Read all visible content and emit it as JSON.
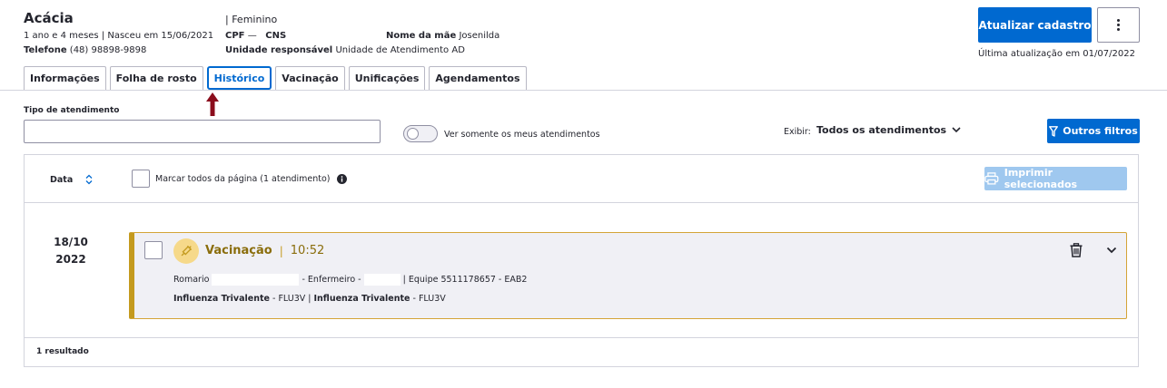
{
  "patient": {
    "name": "Acácia",
    "age_birth": "1 ano e 4 meses | Nasceu em 15/06/2021",
    "phone_label": "Telefone",
    "phone": "(48) 98898-9898",
    "sex": "| Feminino",
    "cpf_label": "CPF",
    "cpf_value": "—",
    "cns_label": "CNS",
    "unit_label": "Unidade responsável",
    "unit_value": "Unidade de Atendimento AD",
    "mother_label": "Nome da mãe",
    "mother_value": "Josenilda"
  },
  "header": {
    "update_button": "Atualizar cadastro",
    "last_update": "Última atualização em 01/07/2022"
  },
  "tabs": [
    {
      "label": "Informações"
    },
    {
      "label": "Folha de rosto"
    },
    {
      "label": "Histórico"
    },
    {
      "label": "Vacinação"
    },
    {
      "label": "Unificações"
    },
    {
      "label": "Agendamentos"
    }
  ],
  "filters": {
    "type_label": "Tipo de atendimento",
    "type_value": "",
    "toggle_label": "Ver somente os meus atendimentos",
    "show_label": "Exibir:",
    "show_value": "Todos os atendimentos",
    "other_filters": "Outros filtros"
  },
  "table": {
    "date_header": "Data",
    "select_all": "Marcar todos da página (1 atendimento)",
    "print_button": "Imprimir selecionados",
    "result_count": "1 resultado"
  },
  "record": {
    "day_month": "18/10",
    "year": "2022",
    "type": "Vacinação",
    "time": "10:52",
    "professional": "Romario",
    "role": "- Enfermeiro -",
    "team": "| Equipe 5511178657 - EAB2",
    "vaccine1_name": "Influenza Trivalente",
    "vaccine1_code": "- FLU3V |",
    "vaccine2_name": "Influenza Trivalente",
    "vaccine2_code": "- FLU3V"
  },
  "colors": {
    "primary": "#0069d0",
    "vaccine_accent": "#c49a1e",
    "marker_arrow": "#8b0d1c"
  }
}
